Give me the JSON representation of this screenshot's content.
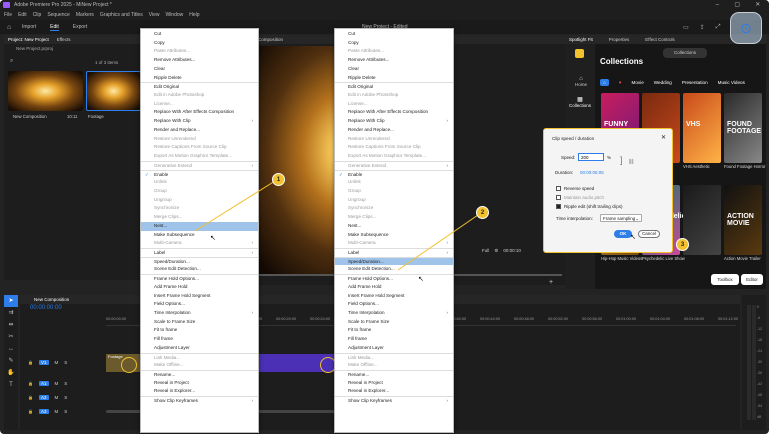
{
  "app": {
    "title": "Adobe Premiere Pro 2025 - MiNew Project *",
    "project_title": "New Project - Edited"
  },
  "menubar": [
    "File",
    "Edit",
    "Clip",
    "Sequence",
    "Markers",
    "Graphics and Titles",
    "View",
    "Window",
    "Help"
  ],
  "header": {
    "tabs": [
      "Import",
      "Edit",
      "Export"
    ]
  },
  "project": {
    "tab": "Project: New Project",
    "tab2": "Effects",
    "file": "New Project.prproj",
    "count": "1 of 3 items",
    "items": [
      {
        "name": "New Composition",
        "dur": "10:11"
      },
      {
        "name": "Footage",
        "dur": ""
      }
    ]
  },
  "monitor": {
    "tab": "Composition",
    "zoom": "Full",
    "timecode": "00:00:10"
  },
  "spotlight": {
    "tab": "Spotlight Fit",
    "tab2": "Properties",
    "tab3": "Effect Controls",
    "header": "Collections",
    "title": "Collections",
    "nav": [
      "Home",
      "Collections"
    ],
    "categories": [
      "Movie",
      "Wedding",
      "Presentation",
      "Music Videos"
    ],
    "tiles": [
      {
        "label": "FUNNY",
        "caption": ""
      },
      {
        "label": "",
        "caption": ""
      },
      {
        "label": "VHS",
        "caption": "VHS Aesthetic"
      },
      {
        "label": "FOUND FOOTAGE",
        "caption": "Found Footage Horror"
      },
      {
        "label": "",
        "caption": "Hip-Hop Music Videos"
      },
      {
        "label": "Psychedelic",
        "caption": "Psychedelic Live Show"
      },
      {
        "label": "",
        "caption": ""
      },
      {
        "label": "ACTION MOVIE",
        "caption": "Action Movie Trailer"
      }
    ],
    "buttons": {
      "toolbox": "Toolbox",
      "editor": "Editor"
    }
  },
  "timeline": {
    "tab": "New Composition",
    "timecode": "00:00:00:00",
    "ruler": [
      "00:00:00:00",
      "00:00:04:00",
      "00:00:08:00",
      "00:00:12:00",
      "00:00:16:00",
      "00:00:20:00",
      "00:00:24:00",
      "00:00:28:00",
      "00:00:32:00",
      "00:00:36:00",
      "00:00:40:00",
      "00:00:44:00",
      "00:00:48:00",
      "00:00:52:00",
      "00:00:56:00",
      "00:01:00:00",
      "00:01:04:00",
      "00:01:08:00",
      "00:01:12:00"
    ],
    "tracks": [
      "V1",
      "A1",
      "A2",
      "A3"
    ],
    "clip": "Footage",
    "meter_labels": [
      "0",
      "-6",
      "-12",
      "-18",
      "-24",
      "-30",
      "-36",
      "-42",
      "-48",
      "-54",
      "dB"
    ]
  },
  "context_menu": {
    "items": [
      {
        "label": "Cut",
        "state": "normal"
      },
      {
        "label": "Copy",
        "state": "normal"
      },
      {
        "label": "Paste Attributes...",
        "state": "disabled"
      },
      {
        "label": "Remove Attributes...",
        "state": "normal"
      },
      {
        "label": "Clear",
        "state": "normal"
      },
      {
        "label": "Ripple Delete",
        "state": "normal"
      },
      {
        "label": "Edit Original",
        "state": "normal",
        "sep": true
      },
      {
        "label": "Edit in Adobe Photoshop",
        "state": "disabled"
      },
      {
        "label": "License...",
        "state": "disabled"
      },
      {
        "label": "Replace With After Effects Composition",
        "state": "normal"
      },
      {
        "label": "Replace With Clip",
        "state": "normal",
        "arrow": true
      },
      {
        "label": "Render and Replace...",
        "state": "normal"
      },
      {
        "label": "Restore Unrendered",
        "state": "disabled"
      },
      {
        "label": "Restore Captions From Source Clip",
        "state": "disabled"
      },
      {
        "label": "Export As Motion Graphics Template...",
        "state": "disabled"
      },
      {
        "label": "Generative Extend",
        "state": "disabled",
        "arrow": true,
        "sep": true
      },
      {
        "label": "Enable",
        "state": "checked",
        "sep": true
      },
      {
        "label": "Unlink",
        "state": "disabled"
      },
      {
        "label": "Group",
        "state": "disabled"
      },
      {
        "label": "Ungroup",
        "state": "disabled"
      },
      {
        "label": "Synchronize",
        "state": "disabled"
      },
      {
        "label": "Merge Clips...",
        "state": "disabled"
      },
      {
        "label": "Nest...",
        "state": "normal"
      },
      {
        "label": "Make Subsequence",
        "state": "normal"
      },
      {
        "label": "Multi-Camera",
        "state": "disabled",
        "arrow": true
      },
      {
        "label": "Label",
        "state": "normal",
        "arrow": true,
        "sep": true
      },
      {
        "label": "Speed/Duration...",
        "state": "normal",
        "sep": true
      },
      {
        "label": "Scene Edit Detection...",
        "state": "normal"
      },
      {
        "label": "Frame Hold Options...",
        "state": "normal",
        "sep": true
      },
      {
        "label": "Add Frame Hold",
        "state": "normal"
      },
      {
        "label": "Insert Frame Hold Segment",
        "state": "normal"
      },
      {
        "label": "Field Options...",
        "state": "normal"
      },
      {
        "label": "Time Interpolation",
        "state": "normal",
        "arrow": true
      },
      {
        "label": "Scale to Frame Size",
        "state": "normal"
      },
      {
        "label": "Fit to frame",
        "state": "normal"
      },
      {
        "label": "Fill frame",
        "state": "normal"
      },
      {
        "label": "Adjustment Layer",
        "state": "normal"
      },
      {
        "label": "Link Media...",
        "state": "disabled",
        "sep": true
      },
      {
        "label": "Make Offline...",
        "state": "disabled"
      },
      {
        "label": "Rename...",
        "state": "normal",
        "sep": true
      },
      {
        "label": "Reveal in Project",
        "state": "normal"
      },
      {
        "label": "Reveal in Explorer...",
        "state": "normal"
      },
      {
        "label": "Show Clip Keyframes",
        "state": "normal",
        "arrow": true,
        "sep": true
      }
    ]
  },
  "dialog": {
    "title": "Clip speed / duration",
    "speed_label": "Speed:",
    "speed_value": "200",
    "speed_unit": "%",
    "duration_label": "Duration:",
    "duration_value": "00:00:05:05",
    "checkboxes": [
      {
        "label": "Reverse speed",
        "checked": false
      },
      {
        "label": "Maintain audio pitch",
        "checked": false
      },
      {
        "label": "Ripple edit (shift trailing clips)",
        "checked": true
      }
    ],
    "interp_label": "Time interpolation:",
    "interp_value": "Frame sampling",
    "ok": "OK",
    "cancel": "Cancel"
  },
  "callouts": [
    "1",
    "2",
    "3"
  ],
  "colors": {
    "accent": "#2d7ee8",
    "highlight": "#9fc3e9",
    "callout": "#f2c12e",
    "clip": "#4b2fb4"
  }
}
